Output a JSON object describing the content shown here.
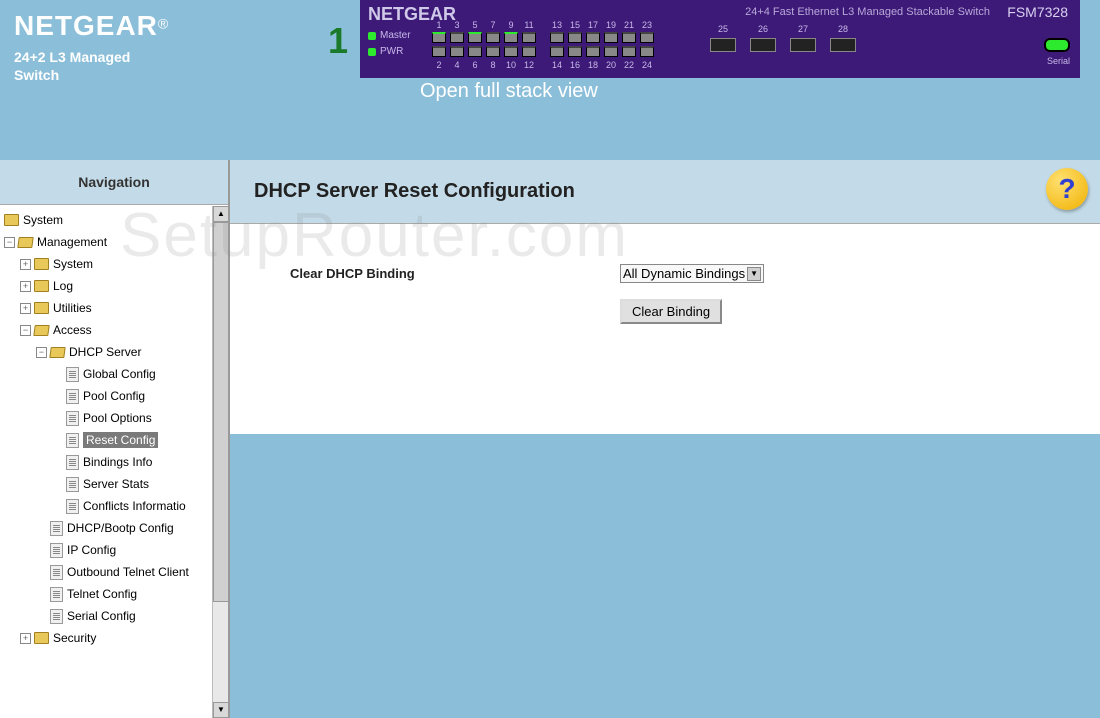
{
  "brand": {
    "name": "NETGEAR",
    "reg": "®",
    "subtitle_line1": "24+2 L3 Managed",
    "subtitle_line2": "Switch"
  },
  "stack": {
    "unit_number": "1",
    "open_link": "Open full stack view"
  },
  "switch": {
    "brand": "NETGEAR",
    "description": "24+4 Fast Ethernet L3 Managed Stackable Switch",
    "model": "FSM7328",
    "led_master": "Master",
    "led_pwr": "PWR",
    "top_port_numbers": [
      "1",
      "3",
      "5",
      "7",
      "9",
      "11",
      "13",
      "15",
      "17",
      "19",
      "21",
      "23"
    ],
    "bottom_port_numbers": [
      "2",
      "4",
      "6",
      "8",
      "10",
      "12",
      "14",
      "16",
      "18",
      "20",
      "22",
      "24"
    ],
    "gbic_numbers": [
      "25",
      "26",
      "27",
      "28"
    ],
    "serial_label": "Serial"
  },
  "nav": {
    "header": "Navigation",
    "tree": {
      "system": "System",
      "management": "Management",
      "mgmt_system": "System",
      "mgmt_log": "Log",
      "mgmt_utilities": "Utilities",
      "mgmt_access": "Access",
      "dhcp_server": "DHCP Server",
      "global_config": "Global Config",
      "pool_config": "Pool Config",
      "pool_options": "Pool Options",
      "reset_config": "Reset Config",
      "bindings_info": "Bindings Info",
      "server_stats": "Server Stats",
      "conflicts": "Conflicts Informatio",
      "dhcp_bootp": "DHCP/Bootp Config",
      "ip_config": "IP Config",
      "outbound_telnet": "Outbound Telnet Client",
      "telnet_config": "Telnet Config",
      "serial_config": "Serial Config",
      "security": "Security"
    }
  },
  "content": {
    "title": "DHCP Server Reset Configuration",
    "form_label": "Clear DHCP Binding",
    "select_value": "All Dynamic Bindings",
    "button_label": "Clear Binding",
    "help": "?"
  },
  "watermark": "SetupRouter.com"
}
